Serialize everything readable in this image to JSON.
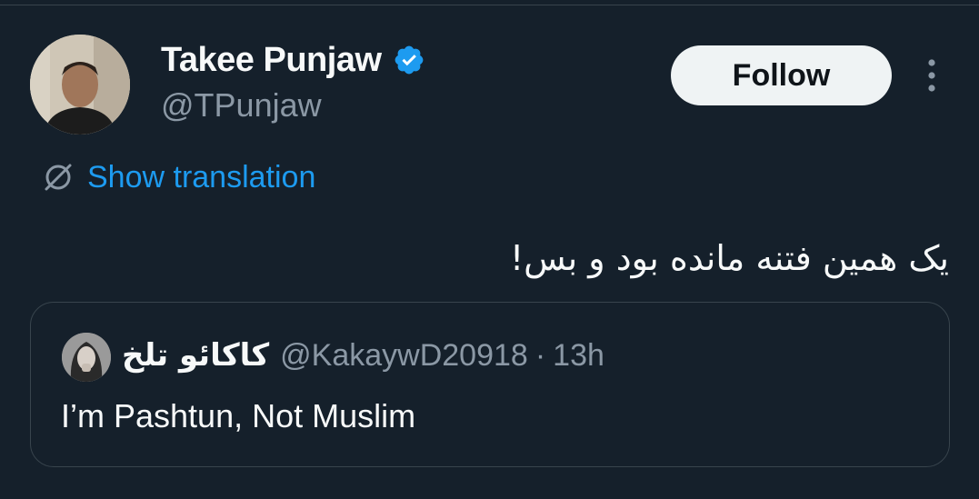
{
  "author": {
    "display_name": "Takee Punjaw",
    "handle": "@TPunjaw",
    "verified": true
  },
  "actions": {
    "follow_label": "Follow"
  },
  "translation": {
    "label": "Show translation"
  },
  "tweet": {
    "text": "یک همین فتنه مانده بود و بس!"
  },
  "quote": {
    "name": "کاکائو تلخ",
    "handle": "@KakaywD20918",
    "separator": "·",
    "time": "13h",
    "text": "I’m Pashtun, Not Muslim"
  },
  "colors": {
    "background": "#15202b",
    "accent": "#1d9bf0",
    "secondary_text": "#8b98a5",
    "primary_text": "#f7f9f9"
  }
}
